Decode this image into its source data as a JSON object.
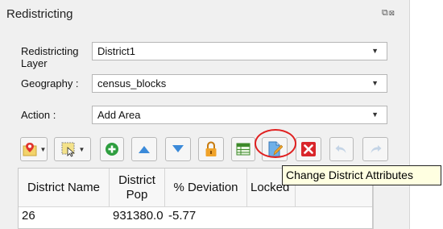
{
  "window": {
    "title": "Redistricting"
  },
  "fields": {
    "layer": {
      "label_line1": "Redistricting",
      "label_line2": "Layer",
      "value": "District1"
    },
    "geography": {
      "label": "Geography :",
      "value": "census_blocks"
    },
    "action": {
      "label": "Action :",
      "value": "Add Area"
    }
  },
  "toolbar": {
    "tooltip": "Change District Attributes",
    "icons": [
      "map-pin-icon",
      "select-features-icon",
      "add-icon",
      "move-up-icon",
      "move-down-icon",
      "lock-icon",
      "table-icon",
      "edit-attributes-icon",
      "delete-icon",
      "undo-icon",
      "redo-icon"
    ]
  },
  "table": {
    "headers": {
      "name": "District Name",
      "pop_line1": "District",
      "pop_line2": "Pop",
      "deviation": "% Deviation",
      "locked": "Locked"
    },
    "rows": [
      {
        "name": "26",
        "pop": "931380.0",
        "deviation": "-5.77",
        "locked": ""
      }
    ]
  },
  "colors": {
    "highlight": "#e02020",
    "tooltip_bg": "#ffffe1",
    "add_green": "#2e9e3f",
    "delete_red": "#d9262b",
    "arrow_blue": "#3b8ad9",
    "lock_orange": "#f0a32a"
  }
}
